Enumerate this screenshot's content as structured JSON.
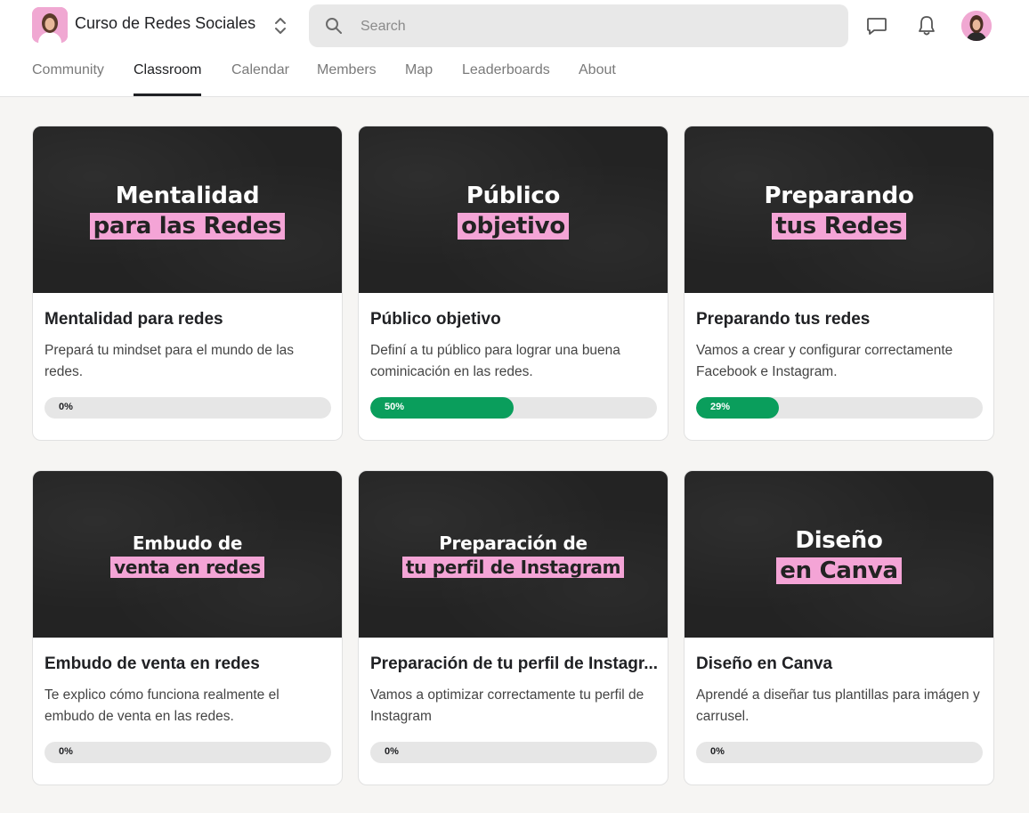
{
  "header": {
    "group_name": "Curso de Redes Sociales",
    "search_placeholder": "Search",
    "icons": [
      "chat-icon",
      "bell-icon"
    ]
  },
  "tabs": [
    {
      "label": "Community",
      "active": false
    },
    {
      "label": "Classroom",
      "active": true
    },
    {
      "label": "Calendar",
      "active": false
    },
    {
      "label": "Members",
      "active": false
    },
    {
      "label": "Map",
      "active": false
    },
    {
      "label": "Leaderboards",
      "active": false
    },
    {
      "label": "About",
      "active": false
    }
  ],
  "colors": {
    "accent_pink": "#f4a4d6",
    "progress_green": "#0a9e5c",
    "thumbnail_bg": "#232323"
  },
  "courses": [
    {
      "thumb_line1": "Mentalidad",
      "thumb_line2": "para las Redes",
      "title": "Mentalidad para redes",
      "description": "Prepará tu mindset para el mundo de las redes.",
      "progress": 0,
      "progress_label": "0%"
    },
    {
      "thumb_line1": "Público",
      "thumb_line2": "objetivo",
      "title": "Público objetivo",
      "description": "Definí a tu público para lograr una buena cominicación en las redes.",
      "progress": 50,
      "progress_label": "50%"
    },
    {
      "thumb_line1": "Preparando",
      "thumb_line2": "tus Redes",
      "title": "Preparando tus redes",
      "description": "Vamos a crear y configurar correctamente Facebook e Instagram.",
      "progress": 29,
      "progress_label": "29%"
    },
    {
      "thumb_line1": "Embudo de",
      "thumb_line2": "venta en redes",
      "title": "Embudo de venta en redes",
      "description": "Te explico cómo funciona realmente el embudo de venta en las redes.",
      "progress": 0,
      "progress_label": "0%"
    },
    {
      "thumb_line1": "Preparación de",
      "thumb_line2": "tu perfil de Instagram",
      "title": "Preparación de tu perfil de Instagr...",
      "description": "Vamos a optimizar correctamente tu perfil de Instagram",
      "progress": 0,
      "progress_label": "0%"
    },
    {
      "thumb_line1": "Diseño",
      "thumb_line2": "en Canva",
      "title": "Diseño en Canva",
      "description": "Aprendé a diseñar tus plantillas para imágen y carrusel.",
      "progress": 0,
      "progress_label": "0%"
    }
  ]
}
